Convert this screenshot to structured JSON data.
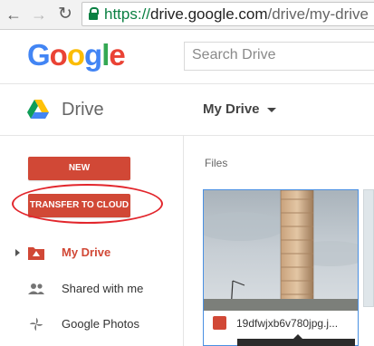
{
  "browser": {
    "url_scheme": "https://",
    "url_host": "drive.google.com",
    "url_path": "/drive/my-drive"
  },
  "header": {
    "logo": [
      "G",
      "o",
      "o",
      "g",
      "l",
      "e"
    ],
    "search_placeholder": "Search Drive"
  },
  "drive_header": {
    "app_name": "Drive",
    "location_menu": "My Drive"
  },
  "sidebar": {
    "new_button": "NEW",
    "transfer_button": "TRANSFER TO CLOUD",
    "items": [
      {
        "label": "My Drive",
        "icon": "my-drive-icon",
        "active": true
      },
      {
        "label": "Shared with me",
        "icon": "shared-people-icon",
        "active": false
      },
      {
        "label": "Google Photos",
        "icon": "google-photos-icon",
        "active": false
      }
    ]
  },
  "main": {
    "section_label": "Files",
    "files": [
      {
        "name": "19dfwjxb6v780jpg.j...",
        "icon": "image-file-icon"
      }
    ]
  },
  "colors": {
    "accent_red": "#d14836",
    "annotation": "#e2262c",
    "selection_blue": "#4a90e2",
    "secure_green": "#0b8043"
  }
}
